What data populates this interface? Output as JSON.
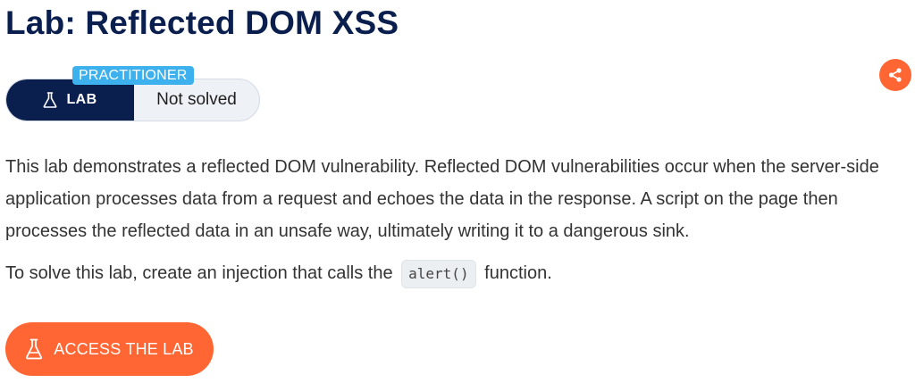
{
  "page": {
    "title": "Lab: Reflected DOM XSS"
  },
  "badge": {
    "level": "PRACTITIONER",
    "type_label": "LAB",
    "status": "Not solved",
    "type_icon": "flask-icon"
  },
  "share": {
    "icon": "share-icon"
  },
  "description": {
    "paragraph": "This lab demonstrates a reflected DOM vulnerability. Reflected DOM vulnerabilities occur when the server-side application processes data from a request and echoes the data in the response. A script on the page then processes the reflected data in an unsafe way, ultimately writing it to a dangerous sink.",
    "solve_prefix": "To solve this lab, create an injection that calls the",
    "solve_code": "alert()",
    "solve_suffix": "function."
  },
  "cta": {
    "label": "ACCESS THE LAB",
    "icon": "flask-icon"
  },
  "colors": {
    "navy": "#0b1f4f",
    "accent_orange": "#ff6633",
    "practitioner_blue": "#3db1ee"
  }
}
